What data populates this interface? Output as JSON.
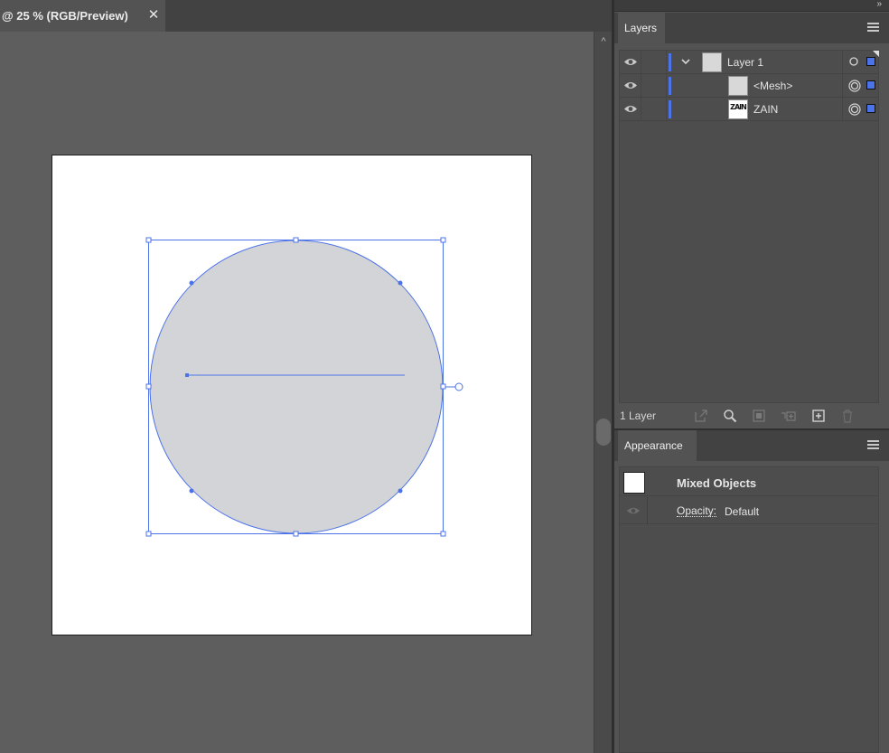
{
  "document": {
    "tab_title": "@ 25 % (RGB/Preview)",
    "close_glyph": "✕",
    "scroll_up_glyph": "^"
  },
  "collapse_glyph": "»",
  "layers_panel": {
    "tab_label": "Layers",
    "layers": [
      {
        "name": "Layer 1",
        "thumbnail": "gray-thumbnail",
        "expanded": true,
        "level": 0
      },
      {
        "name": "<Mesh>",
        "thumbnail": "gray-thumbnail",
        "level": 1
      },
      {
        "name": "ZAIN",
        "thumbnail": "zain-thumbnail",
        "thumb_text": "ZAIN",
        "level": 1
      }
    ],
    "footer_count": "1 Layer",
    "footer_icons": [
      "export-icon",
      "search-icon",
      "make-clipping-mask-icon",
      "new-sublayer-icon",
      "new-layer-icon",
      "delete-icon"
    ]
  },
  "appearance_panel": {
    "tab_label": "Appearance",
    "object_label": "Mixed Objects",
    "opacity_label": "Opacity:",
    "opacity_value": "Default"
  },
  "colors": {
    "selection_blue": "#4d73e8",
    "mesh_fill": "#d3d4d7",
    "panel_bg": "#535353",
    "canvas_bg": "#5e5e5e"
  }
}
